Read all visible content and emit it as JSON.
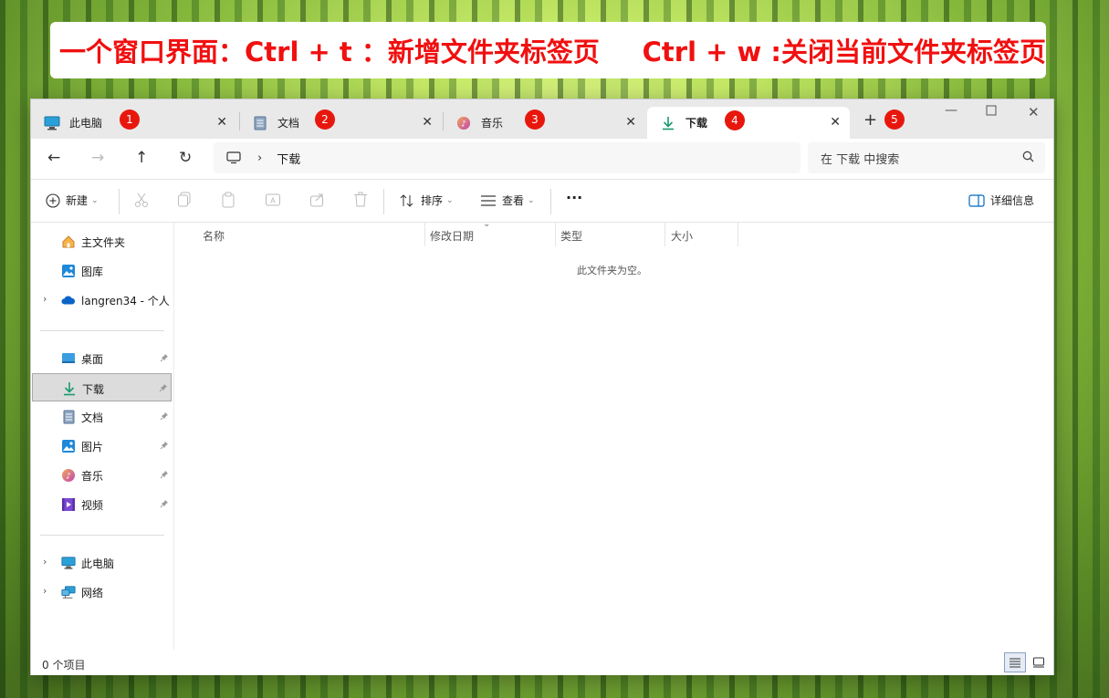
{
  "banner": {
    "text_part1": "一个窗口界面：Ctrl + t ：新增文件夹标签页",
    "text_part2": "Ctrl + w :关闭当前文件夹标签页"
  },
  "tabs": [
    {
      "label": "此电脑",
      "icon": "monitor-icon",
      "badge": "1"
    },
    {
      "label": "文档",
      "icon": "document-icon",
      "badge": "2"
    },
    {
      "label": "音乐",
      "icon": "music-icon",
      "badge": "3"
    },
    {
      "label": "下载",
      "icon": "download-icon",
      "badge": "4",
      "active": true
    }
  ],
  "new_tab": {
    "label": "+",
    "badge": "5"
  },
  "address": {
    "path_current": "下载",
    "search_placeholder": "在 下载 中搜索"
  },
  "toolbar": {
    "new_label": "新建",
    "sort_label": "排序",
    "view_label": "查看",
    "more_label": "···",
    "details_label": "详细信息"
  },
  "sidebar": {
    "group1": [
      {
        "label": "主文件夹",
        "icon": "home-icon"
      },
      {
        "label": "图库",
        "icon": "gallery-icon"
      },
      {
        "label": "langren34 - 个人",
        "icon": "cloud-icon"
      }
    ],
    "group2": [
      {
        "label": "桌面",
        "icon": "desktop-icon",
        "pinned": true
      },
      {
        "label": "下载",
        "icon": "download-icon",
        "pinned": true,
        "selected": true
      },
      {
        "label": "文档",
        "icon": "document-icon",
        "pinned": true
      },
      {
        "label": "图片",
        "icon": "picture-icon",
        "pinned": true
      },
      {
        "label": "音乐",
        "icon": "music-icon",
        "pinned": true
      },
      {
        "label": "视频",
        "icon": "video-icon",
        "pinned": true
      }
    ],
    "group3": [
      {
        "label": "此电脑",
        "icon": "monitor-icon"
      },
      {
        "label": "网络",
        "icon": "network-icon"
      }
    ]
  },
  "columns": [
    "名称",
    "修改日期",
    "类型",
    "大小"
  ],
  "empty_message": "此文件夹为空。",
  "status": {
    "item_count": "0 个项目"
  },
  "colors": {
    "accent": "#0067c0",
    "badge": "#e8170e",
    "banner_text": "#f01010"
  }
}
